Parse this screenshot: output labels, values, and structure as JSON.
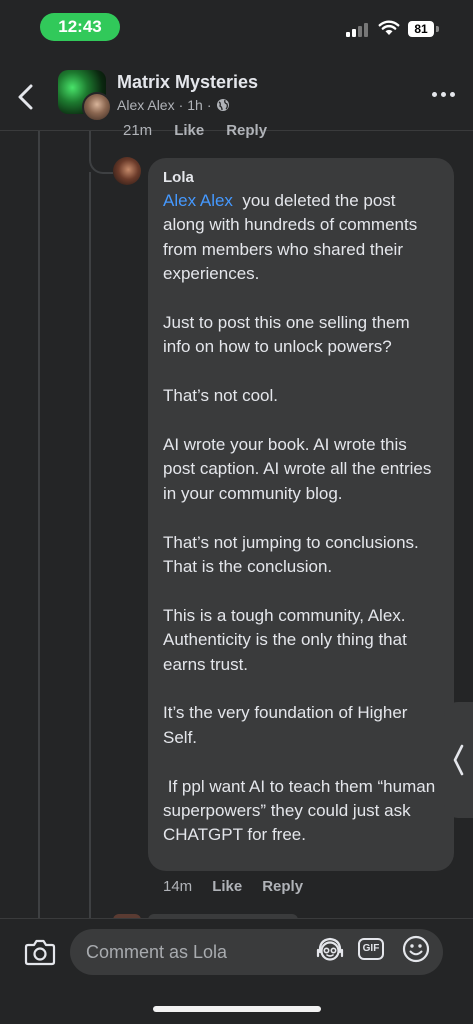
{
  "status_bar": {
    "time": "12:43",
    "battery": "81"
  },
  "header": {
    "title": "Matrix Mysteries",
    "author": "Alex Alex",
    "separator": "·",
    "age": "1h",
    "dot": "·"
  },
  "previous_comment": {
    "time": "21m",
    "like": "Like",
    "reply": "Reply"
  },
  "comment": {
    "author": "Lola",
    "mention": "Alex Alex",
    "paragraphs": [
      "you deleted the post along with hundreds of comments from members who shared their experiences.",
      "Just to post this one selling them info on how to unlock powers?",
      "That’s not cool.",
      "AI wrote your book. AI wrote this post caption. AI wrote all the entries in your community blog.",
      "That’s not jumping to conclusions. That is the conclusion.",
      "This is a tough community, Alex. Authenticity is the only thing that earns trust.",
      "It’s the very foundation of Higher Self.",
      " If ppl want AI to teach them “human superpowers” they could just ask CHATGPT for free."
    ],
    "time": "14m",
    "like": "Like",
    "reply": "Reply"
  },
  "composer": {
    "placeholder": "Comment as Lola",
    "gif_label": "GIF"
  },
  "icons": {
    "back": "chevron-left-icon",
    "globe": "globe-icon",
    "more": "more-icon",
    "camera": "camera-icon",
    "avatar_sticker": "avatar-sticker-icon",
    "gif": "gif-icon",
    "emoji": "emoji-icon"
  },
  "colors": {
    "mention": "#4599ff",
    "time_pill": "#31c95a",
    "bubble": "#3a3b3c"
  }
}
